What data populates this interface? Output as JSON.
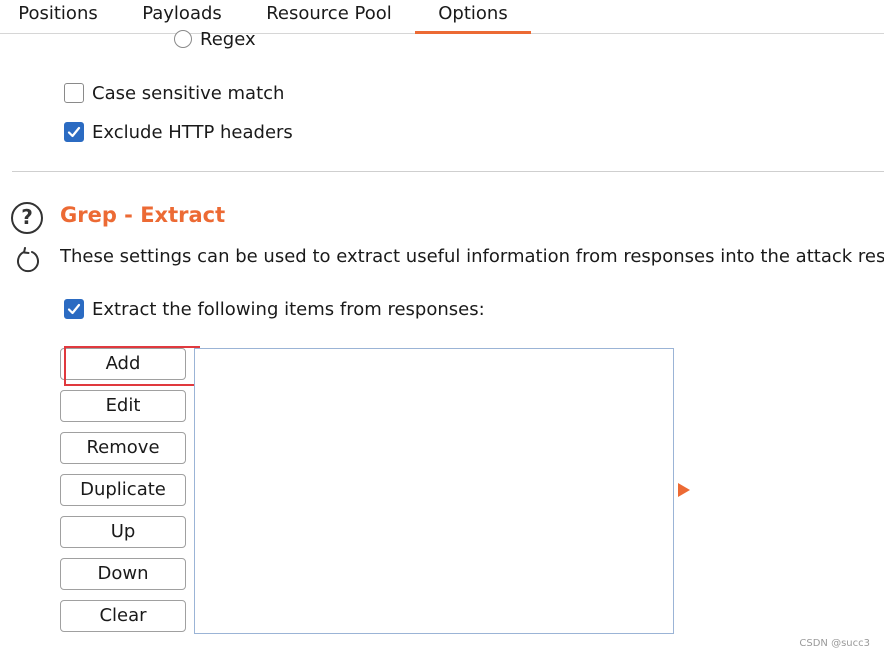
{
  "tabs": [
    {
      "label": "Positions",
      "active": false
    },
    {
      "label": "Payloads",
      "active": false
    },
    {
      "label": "Resource Pool",
      "active": false
    },
    {
      "label": "Options",
      "active": true
    }
  ],
  "match_type": {
    "regex_label": "Regex",
    "regex_selected": false
  },
  "options": {
    "case_sensitive_label": "Case sensitive match",
    "case_sensitive_checked": false,
    "exclude_headers_label": "Exclude HTTP headers",
    "exclude_headers_checked": true
  },
  "grep_extract": {
    "title": "Grep - Extract",
    "description": "These settings can be used to extract useful information from responses into the attack results table.",
    "extract_label": "Extract the following items from responses:",
    "extract_checked": true,
    "buttons": {
      "add": "Add",
      "edit": "Edit",
      "remove": "Remove",
      "duplicate": "Duplicate",
      "up": "Up",
      "down": "Down",
      "clear": "Clear"
    },
    "items": []
  },
  "icons": {
    "help": "help-circle-icon",
    "refresh": "refresh-icon",
    "expand": "expand-arrow-icon"
  },
  "colors": {
    "accent": "#ec6a34",
    "checkbox": "#2b6bc2",
    "highlight": "#e0393e"
  },
  "watermark": "CSDN @succ3"
}
